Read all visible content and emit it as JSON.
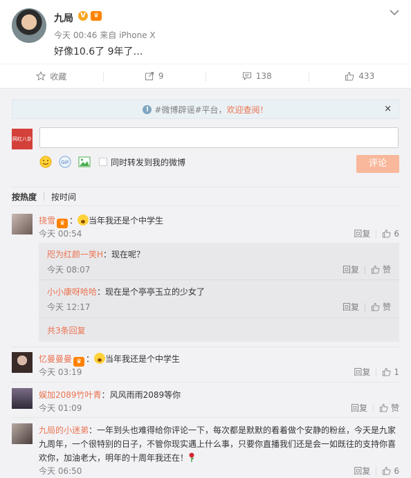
{
  "post": {
    "author": "九局",
    "time": "今天 00:46",
    "source_prefix": "来自",
    "source": "iPhone X",
    "text": "好像10.6了 9年了…"
  },
  "actions": {
    "favorite_label": "收藏",
    "repost_count": "9",
    "comment_count": "138",
    "like_count": "433"
  },
  "notice": {
    "text": "#微博辟谣#平台，",
    "link": "欢迎查阅！",
    "close": "×"
  },
  "composer": {
    "me_avatar_text": "网红八卦",
    "input_value": "",
    "repost_checkbox_label": "同时转发到我的微博",
    "submit_label": "评论"
  },
  "sort": {
    "hot": "按热度",
    "time": "按时间"
  },
  "comments": [
    {
      "name": "挠雪",
      "text": "当年我还是个中学生",
      "time": "今天 00:54",
      "reply_label": "回复",
      "likes": "6"
    },
    {
      "name": "忆曼曼曼",
      "text": "当年我还是个中学生",
      "time": "今天 03:19",
      "reply_label": "回复",
      "likes": "1"
    },
    {
      "name": "娱加2089竹叶青",
      "text": "风风雨雨2089等你",
      "time": "今天 01:09",
      "reply_label": "回复",
      "likes": "赞"
    },
    {
      "name": "九局的小迷弟",
      "text": "一年到头也难得给你评论一下，每次都是默默的看着做个安静的粉丝，今天是九家九周年，一个很特别的日子，不管你现实遇上什么事，只要你直播我们还是会一如既往的支持你喜欢你，加油老大，明年的十周年我还在！",
      "time": "今天 06:50",
      "reply_label": "回复",
      "likes": "6"
    }
  ],
  "replies": [
    {
      "name": "咫为红颜一笑H",
      "text": "现在呢？",
      "time": "今天 08:07",
      "reply_label": "回复",
      "like_label": "赞"
    },
    {
      "name": "小小康呀哈哈",
      "text": "现在是个亭亭玉立的少女了",
      "time": "今天 12:17",
      "reply_label": "回复",
      "like_label": "赞"
    }
  ],
  "more_replies": "共3条回复"
}
